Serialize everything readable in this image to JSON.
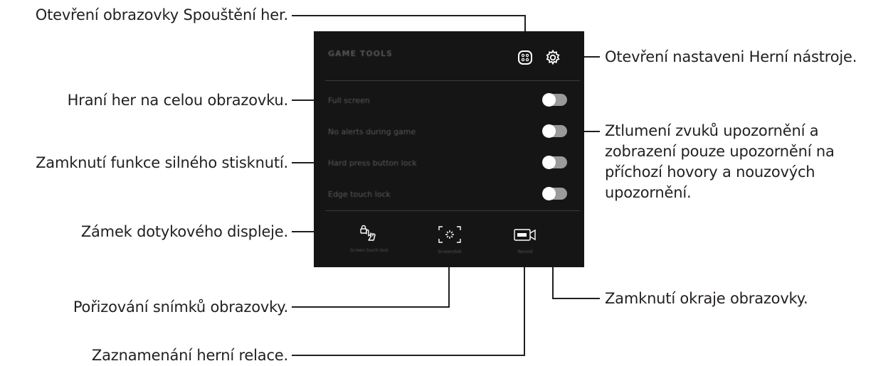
{
  "callouts": {
    "launcher": "Otevření obrazovky Spouštění her.",
    "fullscreen": "Hraní her na celou obrazovku.",
    "hardpress": "Zamknutí funkce silného stisknutí.",
    "touchlock": "Zámek dotykového displeje.",
    "screenshot": "Pořizování snímků obrazovky.",
    "record": "Zaznamenání herní relace.",
    "settings": "Otevření nastaveni Herní nástroje.",
    "alerts": "Ztlumení zvuků upozornění a zobrazení pouze upozornění na příchozí hovory a nouzových upozornění.",
    "edge": "Zamknutí okraje obrazovky."
  },
  "panel": {
    "title": "GAME TOOLS",
    "rows": [
      {
        "label": "Full screen",
        "on": false
      },
      {
        "label": "No alerts during game",
        "on": false
      },
      {
        "label": "Hard press button lock",
        "on": false
      },
      {
        "label": "Edge touch lock",
        "on": false
      }
    ],
    "buttons": {
      "touch_lock": "Screen touch lock",
      "screenshot": "Screenshot",
      "record": "Record"
    }
  },
  "colors": {
    "panel_bg": "#151515",
    "leader_line": "#231f20"
  }
}
